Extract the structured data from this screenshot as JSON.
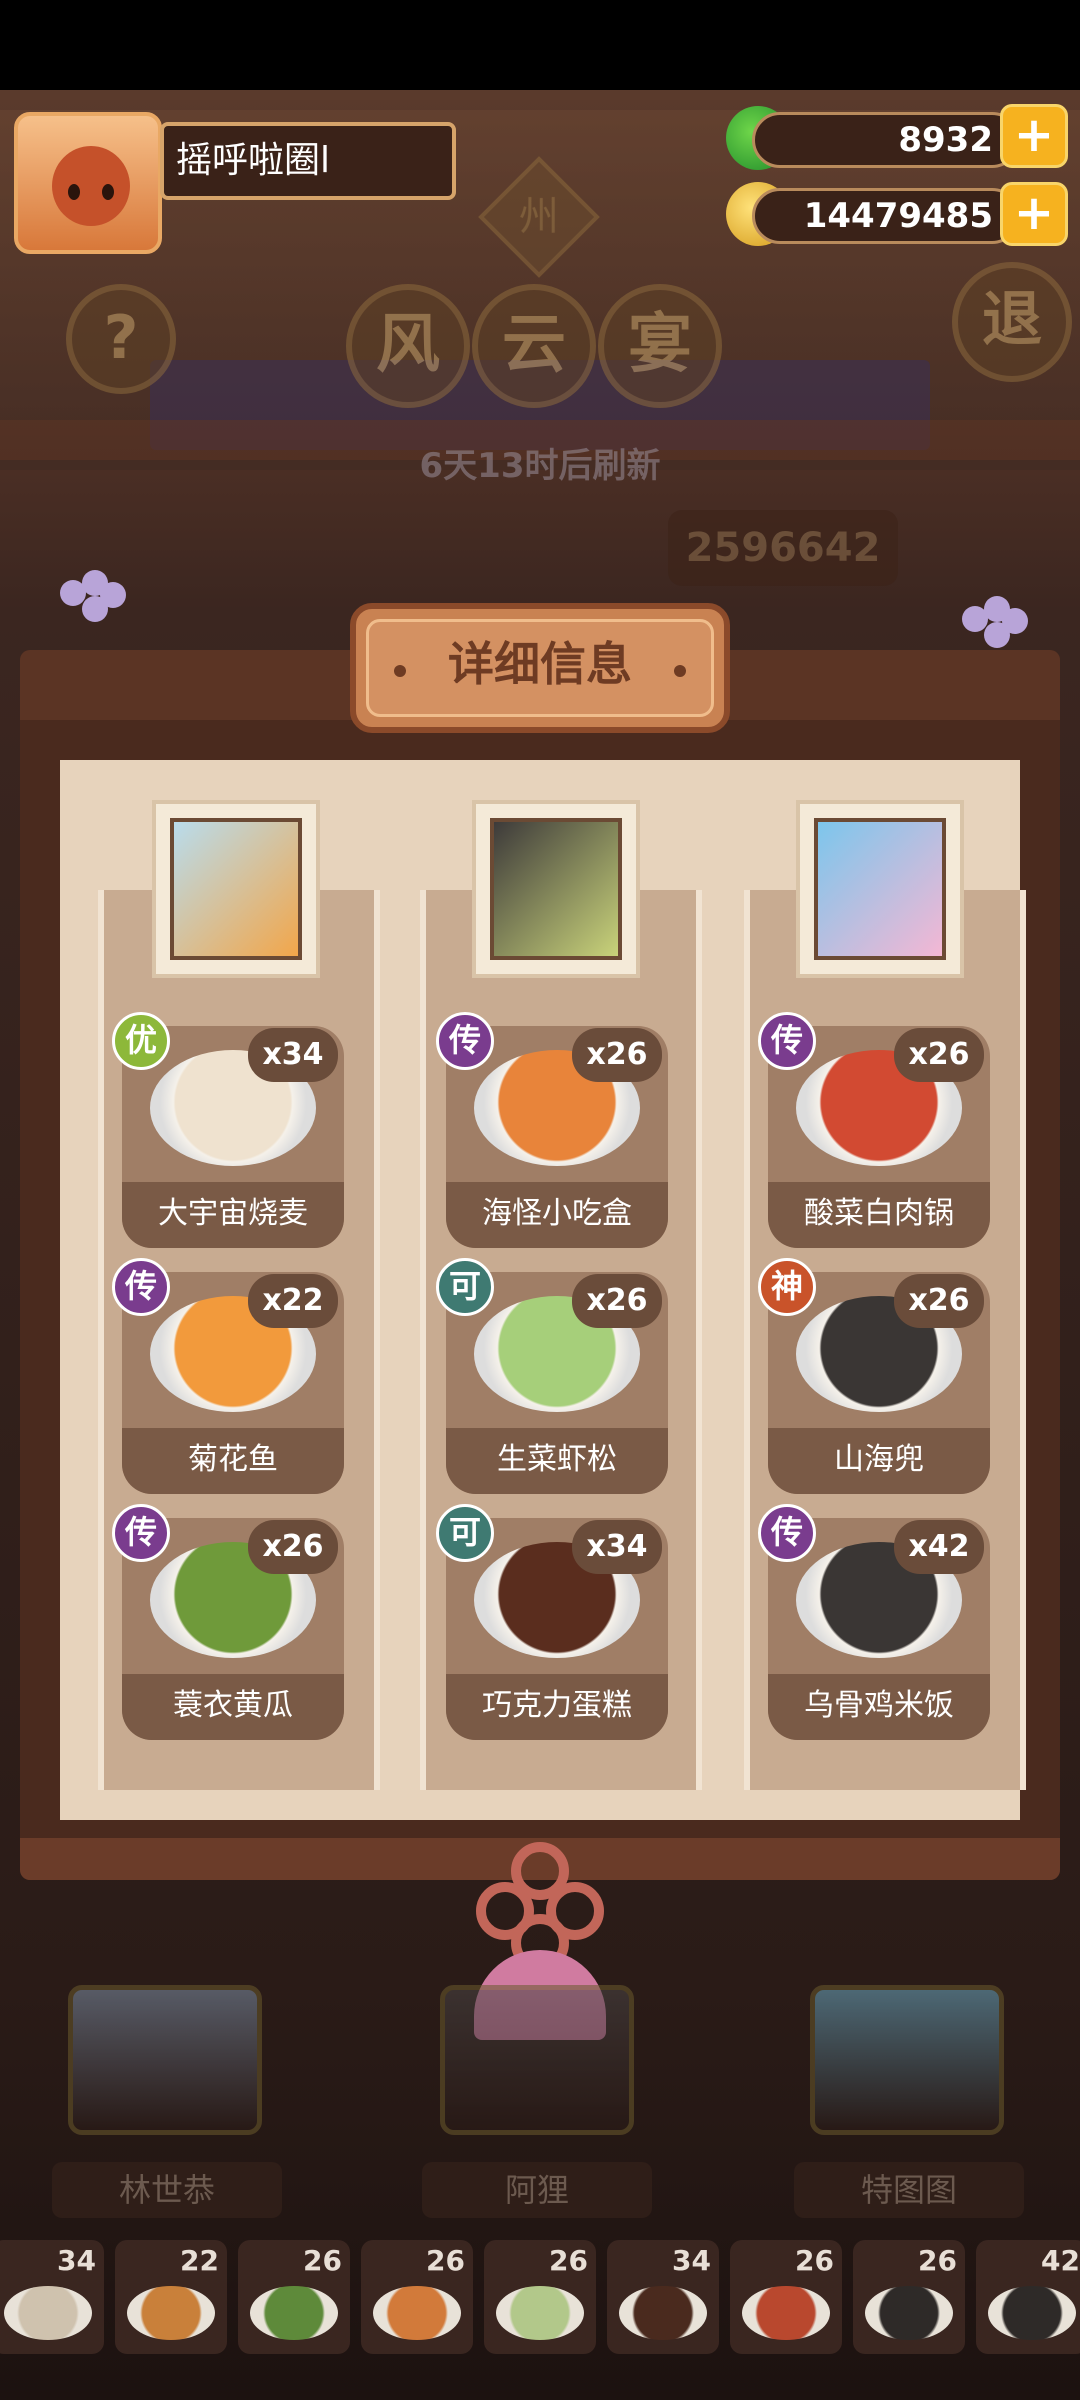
{
  "player": {
    "name": "摇呼啦圈l"
  },
  "resources": {
    "jade": "8932",
    "coins": "14479485",
    "plus": "+"
  },
  "header": {
    "zone_tag": "州",
    "title_chars": [
      "风",
      "云",
      "宴"
    ],
    "help_label": "?",
    "exit_label": "退",
    "refresh_text": "6天13时后刷新",
    "score_text": "2596642"
  },
  "panel": {
    "title": "详细信息",
    "columns": [
      {
        "chef_colors": [
          "#b9dcec",
          "#f2a64a"
        ],
        "dishes": [
          {
            "name": "大宇宙烧麦",
            "count": "x34",
            "rarity": "优",
            "rarity_color": "#8db83a",
            "plate_color": "#efe2cf"
          },
          {
            "name": "菊花鱼",
            "count": "x22",
            "rarity": "传",
            "rarity_color": "#7a3c8e",
            "plate_color": "#f29a3c"
          },
          {
            "name": "蓑衣黄瓜",
            "count": "x26",
            "rarity": "传",
            "rarity_color": "#7a3c8e",
            "plate_color": "#6f9a3a"
          }
        ]
      },
      {
        "chef_colors": [
          "#3d3a3a",
          "#c9d37a"
        ],
        "dishes": [
          {
            "name": "海怪小吃盒",
            "count": "x26",
            "rarity": "传",
            "rarity_color": "#7a3c8e",
            "plate_color": "#e8843a"
          },
          {
            "name": "生菜虾松",
            "count": "x26",
            "rarity": "可",
            "rarity_color": "#3f7a72",
            "plate_color": "#a6cf7a"
          },
          {
            "name": "巧克力蛋糕",
            "count": "x34",
            "rarity": "可",
            "rarity_color": "#3f7a72",
            "plate_color": "#5a2d1e"
          }
        ]
      },
      {
        "chef_colors": [
          "#7cc6ec",
          "#f4b7d4"
        ],
        "dishes": [
          {
            "name": "酸菜白肉锅",
            "count": "x26",
            "rarity": "传",
            "rarity_color": "#7a3c8e",
            "plate_color": "#d24a32"
          },
          {
            "name": "山海兜",
            "count": "x26",
            "rarity": "神",
            "rarity_color": "#c9532a",
            "plate_color": "#3a3634"
          },
          {
            "name": "乌骨鸡米饭",
            "count": "x42",
            "rarity": "传",
            "rarity_color": "#7a3c8e",
            "plate_color": "#3a3634"
          }
        ]
      }
    ]
  },
  "heroes": [
    {
      "name": "林世恭",
      "color": "#7d8fa6"
    },
    {
      "name": "阿狸",
      "color": "#4a4444"
    },
    {
      "name": "特图图",
      "color": "#6aa8c2"
    }
  ],
  "bottom_strip": [
    {
      "count": "34",
      "color": "#cfc2ae"
    },
    {
      "count": "22",
      "color": "#c9803a"
    },
    {
      "count": "26",
      "color": "#5e8a3a"
    },
    {
      "count": "26",
      "color": "#d27a3a"
    },
    {
      "count": "26",
      "color": "#b2c88a"
    },
    {
      "count": "34",
      "color": "#4a2a1e"
    },
    {
      "count": "26",
      "color": "#b9482e"
    },
    {
      "count": "26",
      "color": "#2e2a28"
    },
    {
      "count": "42",
      "color": "#2e2a28"
    }
  ]
}
